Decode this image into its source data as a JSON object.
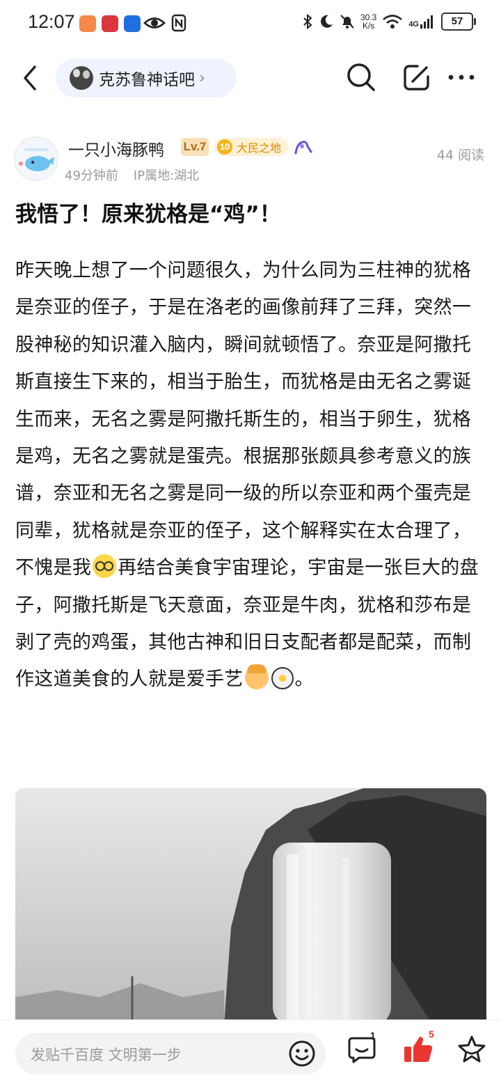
{
  "status_bar": {
    "time": "12:07",
    "net_speed_value": "30.3",
    "net_speed_unit": "K/s",
    "network": "4G",
    "battery": "57"
  },
  "header": {
    "forum_name": "克苏鲁神话吧",
    "forum_chevron": "›"
  },
  "author": {
    "name": "一只小海豚鸭",
    "level": "Lv.7",
    "honor_level": "10",
    "honor_title": "大民之地",
    "time_ago": "49分钟前",
    "ip_location": "IP属地:湖北",
    "reads": "44 阅读"
  },
  "post": {
    "title": "我悟了！原来犹格是“鸡”！",
    "body_part1": "昨天晚上想了一个问题很久，为什么同为三柱神的犹格是奈亚的侄子，于是在洛老的画像前拜了三拜，突然一股神秘的知识灌入脑内，瞬间就顿悟了。奈亚是阿撒托斯直接生下来的，相当于胎生，而犹格是由无名之雾诞生而来，无名之雾是阿撒托斯生的，相当于卵生，犹格是鸡，无名之雾就是蛋壳。根据那张颇具参考意义的族谱，奈亚和无名之雾是同一级的所以奈亚和两个蛋壳是同辈，犹格就是奈亚的侄子，这个解释实在太合理了，不愧是我",
    "body_part2": "再结合美食宇宙理论，宇宙是一张巨大的盘子，阿撒托斯是飞天意面，奈亚是牛肉，犹格和莎布是剥了壳的鸡蛋，其他古神和旧日支配者都是配菜，而制作这道美食的人就是爱手艺",
    "body_part3": "。"
  },
  "bottom_bar": {
    "reply_placeholder": "发贴千百度 文明第一步",
    "comment_count": "1",
    "like_count": "5"
  },
  "colors": {
    "like_red": "#e8372e",
    "pill_bg": "#eef3fd",
    "level_badge_bg": "#f8e0b8"
  },
  "icons": [
    "back-arrow-icon",
    "search-icon",
    "edit-icon",
    "more-icon",
    "emoji-icon",
    "comment-icon",
    "like-icon",
    "star-icon"
  ]
}
